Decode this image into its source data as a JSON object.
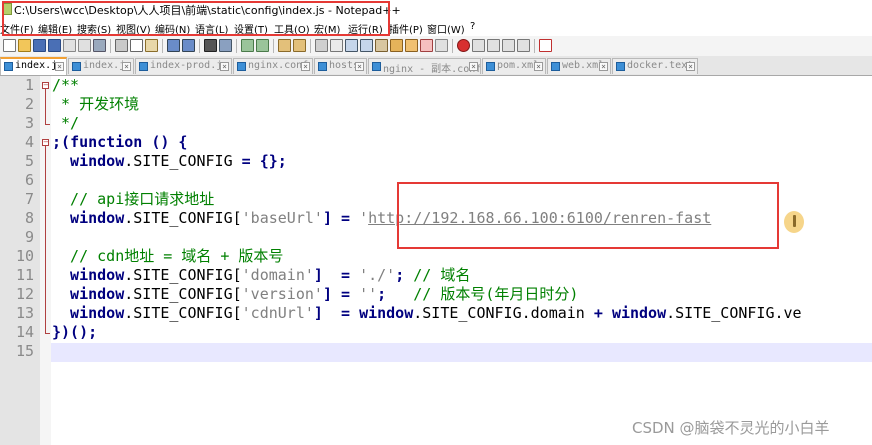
{
  "window": {
    "title": "C:\\Users\\wcc\\Desktop\\人人项目\\前端\\static\\config\\index.js - Notepad++"
  },
  "menu": {
    "items": [
      "文件(F)",
      "编辑(E)",
      "搜索(S)",
      "视图(V)",
      "编码(N)",
      "语言(L)",
      "设置(T)",
      "工具(O)",
      "宏(M)",
      "运行(R)",
      "插件(P)",
      "窗口(W)",
      "?"
    ]
  },
  "tabs": [
    {
      "label": "index.js",
      "active": true
    },
    {
      "label": "index.js",
      "active": false
    },
    {
      "label": "index-prod.js",
      "active": false
    },
    {
      "label": "nginx.conf",
      "active": false
    },
    {
      "label": "hosts",
      "active": false
    },
    {
      "label": "nginx - 副本.conf",
      "active": false
    },
    {
      "label": "pom.xml",
      "active": false
    },
    {
      "label": "web.xml",
      "active": false
    },
    {
      "label": "docker.text",
      "active": false
    }
  ],
  "line_numbers": [
    "1",
    "2",
    "3",
    "4",
    "5",
    "6",
    "7",
    "8",
    "9",
    "10",
    "11",
    "12",
    "13",
    "14",
    "15"
  ],
  "code": {
    "l1": "/**",
    "l2": " * 开发环境",
    "l3": " */",
    "l4": {
      "a": ";(",
      "b": "function",
      "c": " () {"
    },
    "l5": {
      "a": "  window",
      "b": ".SITE_CONFIG ",
      "c": "= {};"
    },
    "l7": "  // api接口请求地址",
    "l8": {
      "a": "  window",
      "b": ".SITE_CONFIG[",
      "c": "'baseUrl'",
      "d": "] = ",
      "e": "'",
      "f": "http://192.168.66.100:6100/renren-fast"
    },
    "l10": "  // cdn地址 = 域名 + 版本号",
    "l11": {
      "a": "  window",
      "b": ".SITE_CONFIG[",
      "c": "'domain'",
      "d": "]  = ",
      "e": "'./'",
      "f": "; ",
      "g": "// 域名"
    },
    "l12": {
      "a": "  window",
      "b": ".SITE_CONFIG[",
      "c": "'version'",
      "d": "] = ",
      "e": "''",
      "f": ";   ",
      "g": "// 版本号(年月日时分)"
    },
    "l13": {
      "a": "  window",
      "b": ".SITE_CONFIG[",
      "c": "'cdnUrl'",
      "d": "]  = ",
      "e": "window",
      "f": ".SITE_CONFIG.domain ",
      "g": "+ ",
      "h": "window",
      "i": ".SITE_CONFIG.ve"
    },
    "l14": "})();"
  },
  "watermark": "CSDN @脑袋不灵光的小白羊",
  "colors": {
    "comment": "#008000",
    "keyword": "#00007f",
    "string": "#808080",
    "line_number_bg": "#e4e4e4",
    "current_line": "#e8e8ff",
    "highlight_box": "#e53935",
    "active_tab_accent": "#f2a033"
  }
}
